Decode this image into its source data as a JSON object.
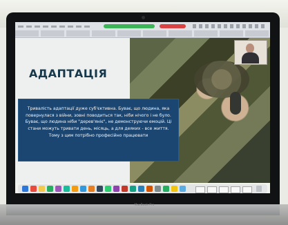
{
  "slide": {
    "title": "АДАПТАЦІЯ",
    "body": "Тривалість адаптації дуже суб'єктивна. Буває, що людина, яка повернулася з війни, зовні поводиться так, ніби нічого і не було. Буває, що людина ніби \"дерев'яніє\", не демонструючи емоцій. Ці стани можуть тривати день, місяць, а для деяких - все життя. Тому з цим потрібно професійно працювати"
  },
  "device": {
    "label": "MacBook Pro"
  },
  "colors": {
    "slide_text_box": "#1b4671",
    "title_text": "#17384a",
    "zoom_green": "#3cb558",
    "zoom_red": "#d94343"
  },
  "icons": {
    "dock": [
      "finder",
      "chrome",
      "notes",
      "zoom",
      "calendar",
      "photos",
      "messages",
      "mail"
    ]
  }
}
